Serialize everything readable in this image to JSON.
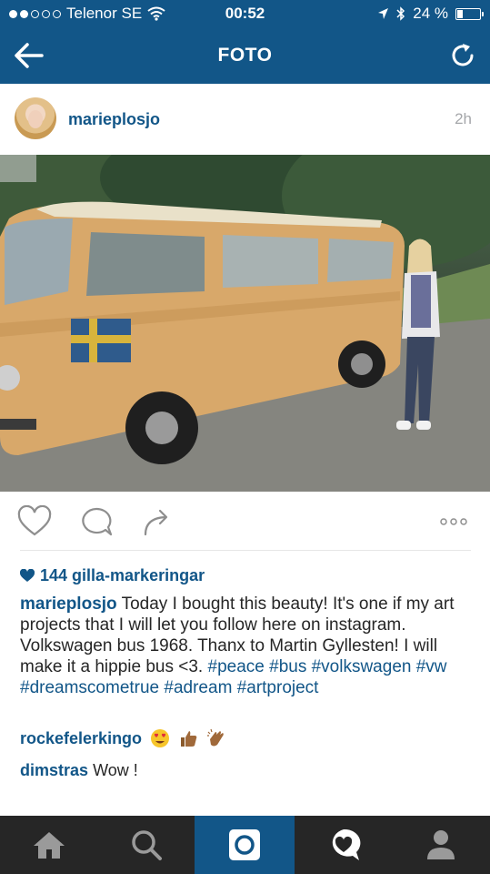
{
  "status_bar": {
    "carrier": "Telenor SE",
    "time": "00:52",
    "battery": "24 %",
    "battery_level": 0.24
  },
  "nav": {
    "title": "FOTO",
    "back_icon": "arrow-left-icon",
    "refresh_icon": "refresh-icon"
  },
  "post": {
    "username": "marieplosjo",
    "time": "2h",
    "likes": "144 gilla-markeringar",
    "caption_user": "marieplosjo",
    "caption_text": "Today I bought this beauty! It's one if my art projects that I will let you follow here on instagram. Volkswagen bus 1968. Thanx to Martin Gyllesten! I will make it a hippie bus <3.",
    "hashtags": [
      "#peace",
      "#bus",
      "#volkswagen",
      "#vw",
      "#dreamscometrue",
      "#adream",
      "#artproject"
    ],
    "comments": [
      {
        "user": "rockefelerkingo",
        "text": "",
        "emojis": [
          "heart-eyes",
          "thumbs-up",
          "clapping-hands"
        ]
      },
      {
        "user": "dimstras",
        "text": "Wow !"
      }
    ]
  },
  "tabs": [
    {
      "name": "home-icon"
    },
    {
      "name": "search-icon"
    },
    {
      "name": "camera-icon",
      "active": true
    },
    {
      "name": "activity-icon"
    },
    {
      "name": "profile-icon"
    }
  ],
  "colors": {
    "brand": "#125688",
    "tabbar": "#262626",
    "muted": "#a5a7aa"
  }
}
